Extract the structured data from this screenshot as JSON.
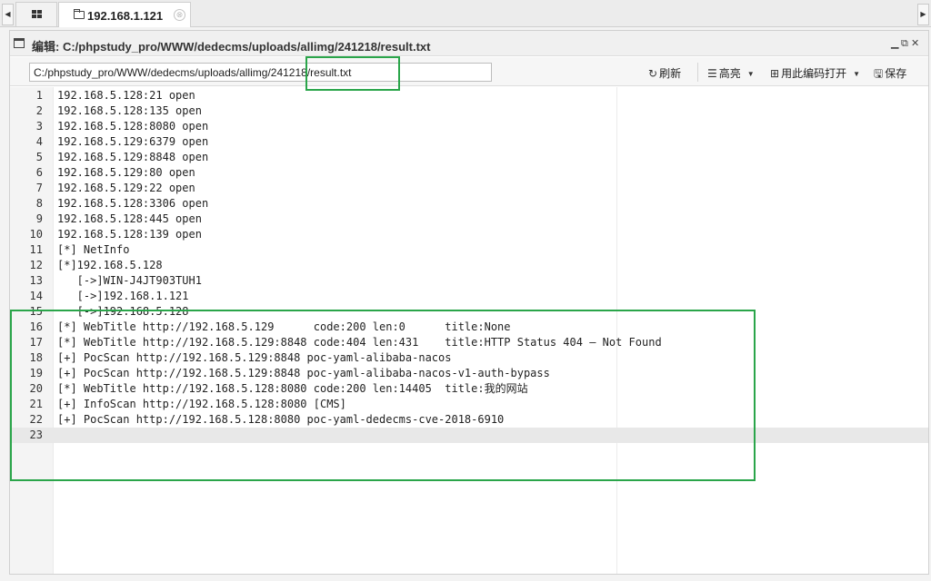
{
  "tabs": {
    "scroll_left": "◀",
    "scroll_right": "▶",
    "grid_icon": "grid-icon",
    "active_tab_label": "192.168.1.121",
    "close_glyph": "⊗"
  },
  "window": {
    "title": "编辑: C:/phpstudy_pro/WWW/dedecms/uploads/allimg/241218/result.txt",
    "controls": [
      "▁",
      "⧉",
      "✕"
    ]
  },
  "toolbar": {
    "path_value": "C:/phpstudy_pro/WWW/dedecms/uploads/allimg/241218/result.txt",
    "refresh_label": "刷新",
    "refresh_icon": "↻",
    "highlight_label": "高亮",
    "highlight_icon": "☰",
    "open_with_encoding_label": "用此编码打开",
    "open_with_encoding_icon": "⊞",
    "save_label": "保存",
    "save_icon": "🖫"
  },
  "editor": {
    "lines": [
      {
        "n": "1",
        "text": "192.168.5.128:21 open"
      },
      {
        "n": "2",
        "text": "192.168.5.128:135 open"
      },
      {
        "n": "3",
        "text": "192.168.5.128:8080 open"
      },
      {
        "n": "4",
        "text": "192.168.5.129:6379 open"
      },
      {
        "n": "5",
        "text": "192.168.5.129:8848 open"
      },
      {
        "n": "6",
        "text": "192.168.5.129:80 open"
      },
      {
        "n": "7",
        "text": "192.168.5.129:22 open"
      },
      {
        "n": "8",
        "text": "192.168.5.128:3306 open"
      },
      {
        "n": "9",
        "text": "192.168.5.128:445 open"
      },
      {
        "n": "10",
        "text": "192.168.5.128:139 open"
      },
      {
        "n": "11",
        "text": "[*] NetInfo"
      },
      {
        "n": "12",
        "text": "[*]192.168.5.128"
      },
      {
        "n": "13",
        "text": "   [->]WIN-J4JT903TUH1"
      },
      {
        "n": "14",
        "text": "   [->]192.168.1.121"
      },
      {
        "n": "15",
        "text": "   [->]192.168.5.128"
      },
      {
        "n": "16",
        "text": "[*] WebTitle http://192.168.5.129      code:200 len:0      title:None"
      },
      {
        "n": "17",
        "text": "[*] WebTitle http://192.168.5.129:8848 code:404 len:431    title:HTTP Status 404 – Not Found"
      },
      {
        "n": "18",
        "text": "[+] PocScan http://192.168.5.129:8848 poc-yaml-alibaba-nacos"
      },
      {
        "n": "19",
        "text": "[+] PocScan http://192.168.5.129:8848 poc-yaml-alibaba-nacos-v1-auth-bypass"
      },
      {
        "n": "20",
        "text": "[*] WebTitle http://192.168.5.128:8080 code:200 len:14405  title:我的网站"
      },
      {
        "n": "21",
        "text": "[+] InfoScan http://192.168.5.128:8080 [CMS]"
      },
      {
        "n": "22",
        "text": "[+] PocScan http://192.168.5.128:8080 poc-yaml-dedecms-cve-2018-6910"
      },
      {
        "n": "23",
        "text": ""
      }
    ],
    "active_line": "23"
  },
  "colors": {
    "annotation_box": "#2aa54a",
    "active_line": "#e8e8e8"
  }
}
